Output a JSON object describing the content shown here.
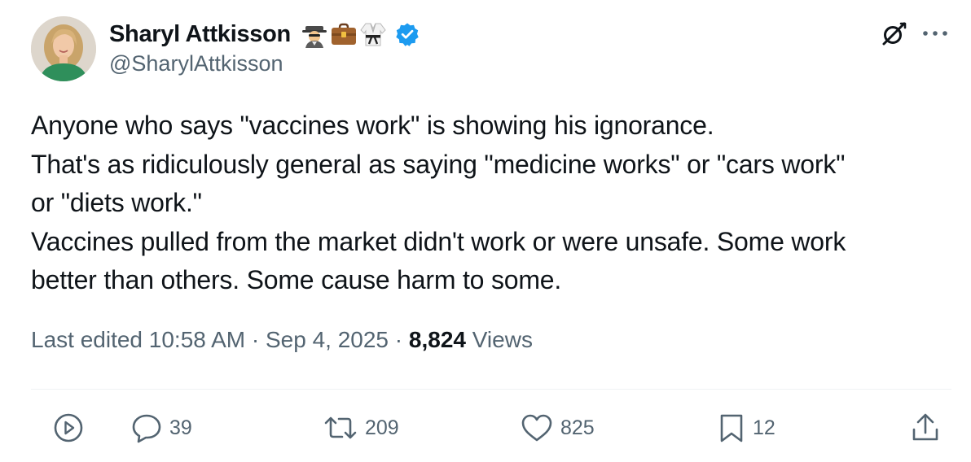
{
  "author": {
    "display_name": "Sharyl Attkisson",
    "handle": "@SharylAttkisson",
    "emojis": [
      "detective-icon",
      "briefcase-icon",
      "martial-arts-uniform-icon"
    ],
    "verified": true
  },
  "tweet": {
    "lines": [
      "Anyone who says \"vaccines work\" is showing his ignorance.",
      "That's as ridiculously general as saying \"medicine works\" or \"cars work\"",
      "or \"diets work.\"",
      "Vaccines pulled from the market didn't work or were unsafe. Some  work",
      "better than others. Some cause harm to some."
    ]
  },
  "meta": {
    "edited_prefix": "Last edited ",
    "time": "10:58 AM",
    "separator": " · ",
    "date": "Sep 4, 2025",
    "views_count": "8,824",
    "views_label": " Views"
  },
  "actions": {
    "replies": "39",
    "reposts": "209",
    "likes": "825",
    "bookmarks": "12"
  },
  "colors": {
    "text": "#0f1419",
    "secondary": "#536471",
    "verified": "#1d9bf0"
  }
}
